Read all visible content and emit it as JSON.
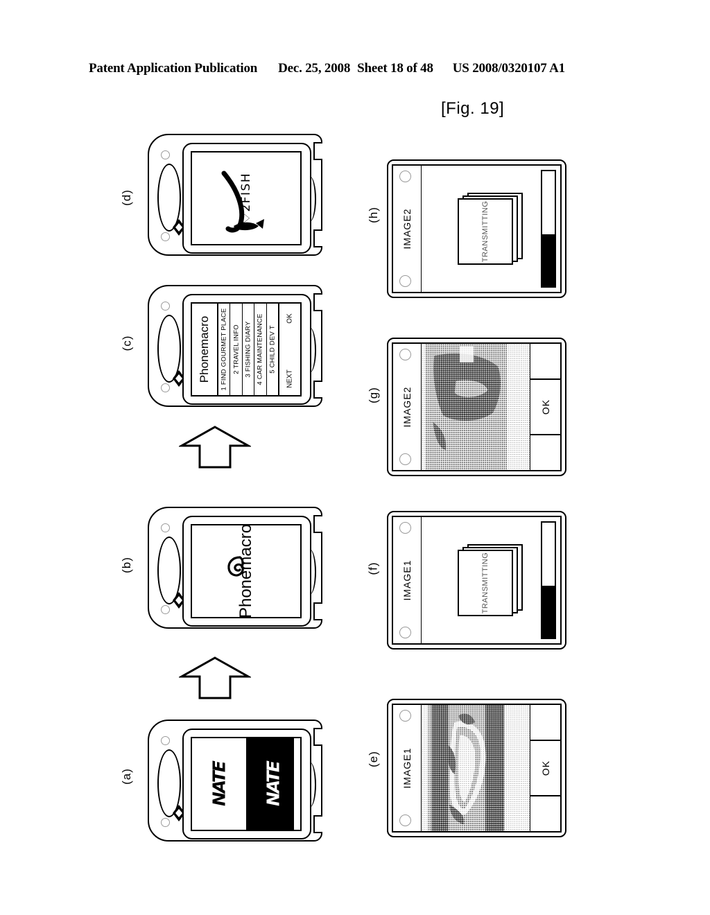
{
  "header": {
    "publication": "Patent Application Publication",
    "date": "Dec. 25, 2008",
    "sheet": "Sheet 18 of 48",
    "patent_number": "US 2008/0320107 A1"
  },
  "figure": {
    "label": "[Fig. 19]"
  },
  "panels": {
    "a": {
      "letter": "(a)",
      "screen_type": "nate-splash",
      "logo_left": "NATE",
      "logo_right": "NATE"
    },
    "b": {
      "letter": "(b)",
      "screen_type": "phonemacro-splash",
      "title": "Phonemacro"
    },
    "c": {
      "letter": "(c)",
      "screen_type": "menu",
      "title": "Phonemacro",
      "items": [
        "1 FIND GOURMET PLACE",
        "2 TRAVEL INFO",
        "3 FISHING DIARY",
        "4 CAR MAINTENANCE",
        "5 CHILD DEV T"
      ],
      "softkey_left": "NEXT",
      "softkey_right": "OK"
    },
    "d": {
      "letter": "(d)",
      "screen_type": "fish-logo",
      "logo_text": "♡2FISH"
    },
    "e": {
      "letter": "(e)",
      "screen_type": "photo",
      "title": "IMAGE1",
      "softkey": "OK"
    },
    "f": {
      "letter": "(f)",
      "screen_type": "transmitting",
      "title": "IMAGE1",
      "card_label": "TRANSMITTING",
      "progress_percent": 45
    },
    "g": {
      "letter": "(g)",
      "screen_type": "photo",
      "title": "IMAGE2",
      "softkey": "OK"
    },
    "h": {
      "letter": "(h)",
      "screen_type": "transmitting",
      "title": "IMAGE2",
      "card_label": "TRANSMITTING",
      "progress_percent": 45
    }
  },
  "arrows": {
    "a_to_b": "arrow-up",
    "b_to_c": "arrow-up"
  },
  "colors": {
    "ink": "#000000",
    "paper": "#ffffff",
    "hole_outline": "#9a9a9a"
  }
}
